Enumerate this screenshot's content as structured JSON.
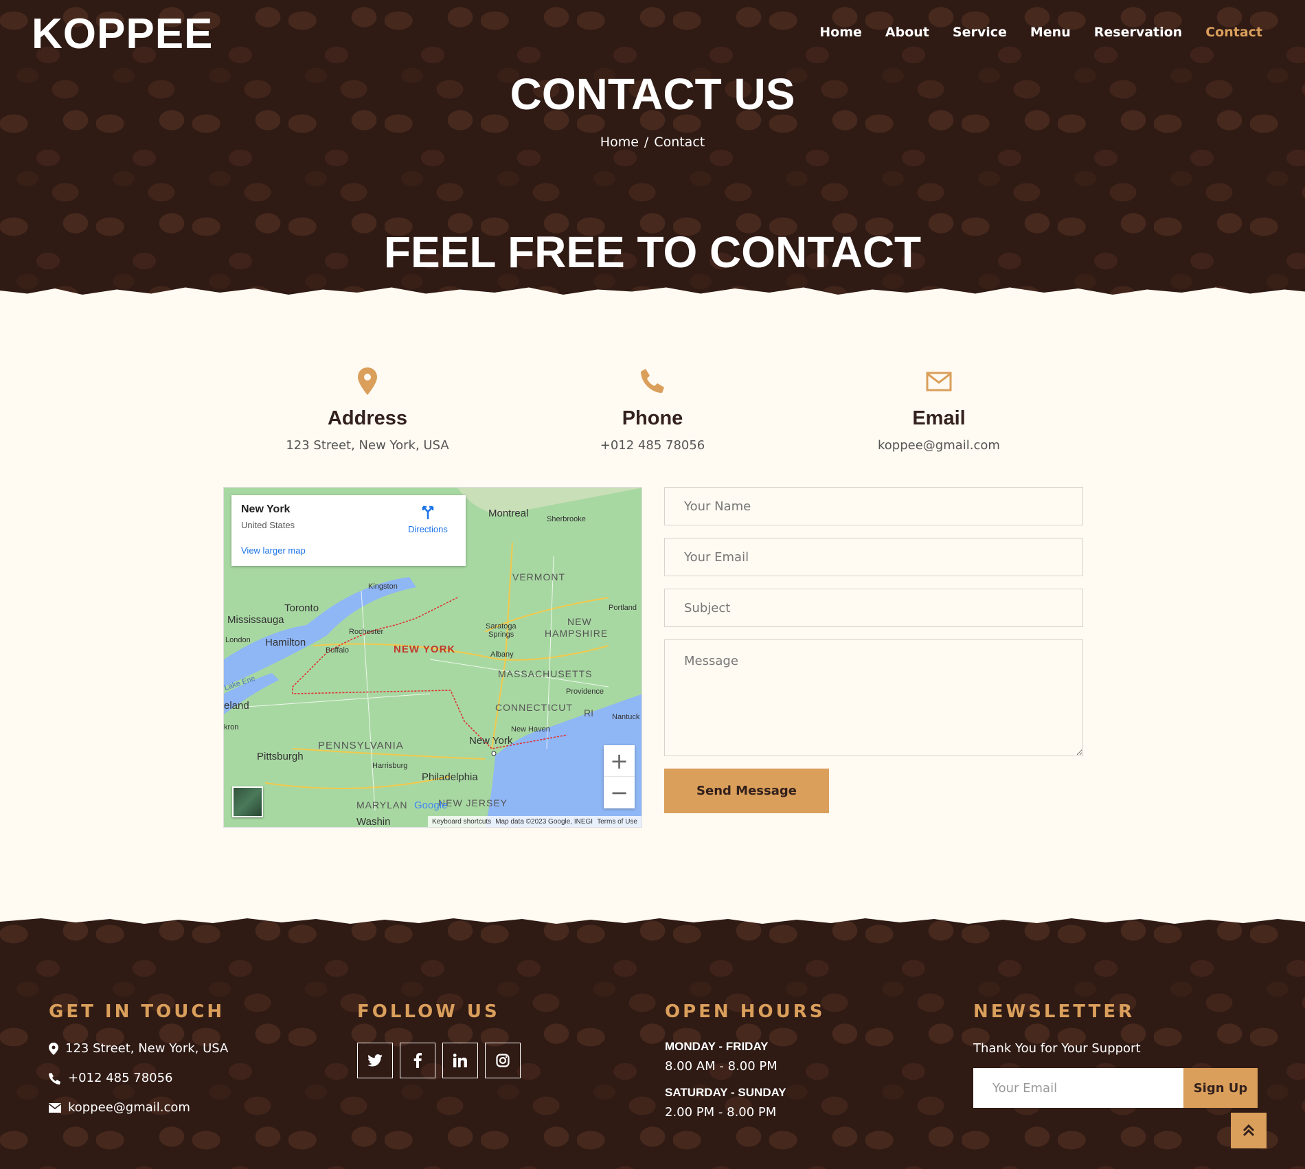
{
  "brand": "KOPPEE",
  "nav": [
    "Home",
    "About",
    "Service",
    "Menu",
    "Reservation",
    "Contact"
  ],
  "nav_active": "Contact",
  "page_title": "CONTACT US",
  "breadcrumb": {
    "home": "Home",
    "separator": "/",
    "current": "Contact"
  },
  "section_title": "FEEL FREE TO CONTACT",
  "info": {
    "address": {
      "icon": "map-marker-icon",
      "title": "Address",
      "value": "123 Street, New York, USA"
    },
    "phone": {
      "icon": "phone-icon",
      "title": "Phone",
      "value": "+012 485 78056"
    },
    "email": {
      "icon": "envelope-icon",
      "title": "Email",
      "value": "koppee@gmail.com"
    }
  },
  "map": {
    "place": "New York",
    "country": "United States",
    "directions": "Directions",
    "larger": "View larger map",
    "labels": [
      "Montreal",
      "Sherbrooke",
      "VERMONT",
      "Portland",
      "Kingston",
      "Toronto",
      "Mississauga",
      "Rochester",
      "Saratoga Springs",
      "NEW HAMPSHIRE",
      "London",
      "Hamilton",
      "Buffalo",
      "NEW YORK",
      "Albany",
      "MASSACHUSETTS",
      "Lake Erie",
      "Providence",
      "eland",
      "CONNECTICUT",
      "RI",
      "Nantuck",
      "kron",
      "New Haven",
      "PENNSYLVANIA",
      "New York",
      "Pittsburgh",
      "Harrisburg",
      "Philadelphia",
      "MARYLAN",
      "NEW JERSEY",
      "Washin"
    ],
    "attribution": [
      "Keyboard shortcuts",
      "Map data ©2023 Google, INEGI",
      "Terms of Use"
    ],
    "google": "Google"
  },
  "form": {
    "name_placeholder": "Your Name",
    "email_placeholder": "Your Email",
    "subject_placeholder": "Subject",
    "message_placeholder": "Message",
    "submit": "Send Message"
  },
  "footer": {
    "get_in_touch": {
      "title": "GET IN TOUCH",
      "address": "123 Street, New York, USA",
      "phone": "+012 485 78056",
      "email": "koppee@gmail.com"
    },
    "follow_us": {
      "title": "FOLLOW US",
      "icons": [
        "twitter-icon",
        "facebook-icon",
        "linkedin-icon",
        "instagram-icon"
      ]
    },
    "open_hours": {
      "title": "OPEN HOURS",
      "weekday_label": "MONDAY - FRIDAY",
      "weekday_hours": "8.00 AM - 8.00 PM",
      "weekend_label": "SATURDAY - SUNDAY",
      "weekend_hours": "2.00 PM - 8.00 PM"
    },
    "newsletter": {
      "title": "NEWSLETTER",
      "text": "Thank You for Your Support",
      "email_placeholder": "Your Email",
      "button": "Sign Up"
    }
  },
  "colors": {
    "accent": "#da9f5b",
    "dark": "#33211d",
    "light": "#fffaf2"
  }
}
